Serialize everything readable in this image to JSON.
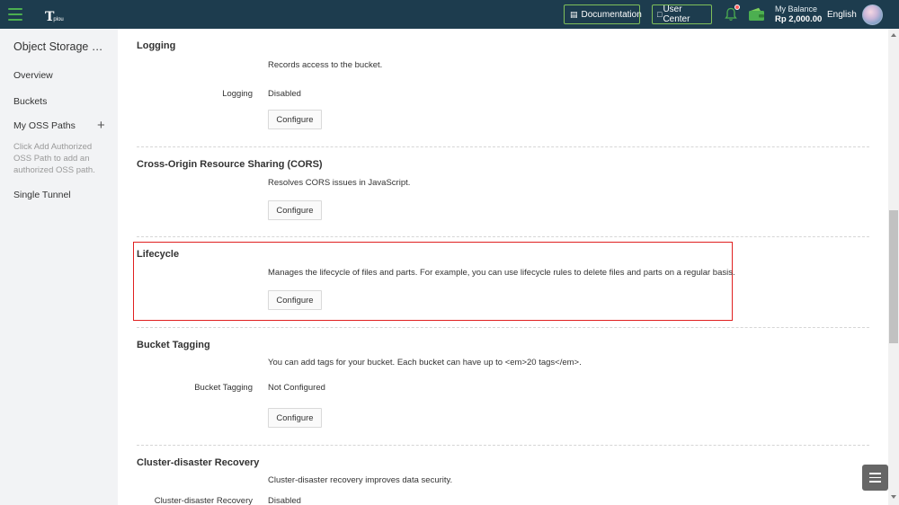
{
  "header": {
    "logo_text": "plou",
    "documentation_label": "Documentation",
    "user_center_label": "User Center",
    "balance_label": "My Balance",
    "balance_amount": "Rp 2,000.00",
    "language": "English"
  },
  "sidebar": {
    "title": "Object Storage Ser...",
    "items": [
      {
        "label": "Overview"
      },
      {
        "label": "Buckets"
      },
      {
        "label": "My OSS Paths"
      },
      {
        "label": "Single Tunnel"
      }
    ],
    "oss_hint": "Click Add Authorized OSS Path to add an authorized OSS path."
  },
  "sections": {
    "logging": {
      "title": "Logging",
      "desc": "Records access to the bucket.",
      "row_label": "Logging",
      "row_value": "Disabled",
      "button": "Configure"
    },
    "cors": {
      "title": "Cross-Origin Resource Sharing (CORS)",
      "desc": "Resolves CORS issues in JavaScript.",
      "button": "Configure"
    },
    "lifecycle": {
      "title": "Lifecycle",
      "desc": "Manages the lifecycle of files and parts. For example, you can use lifecycle rules to delete files and parts on a regular basis.",
      "button": "Configure"
    },
    "tagging": {
      "title": "Bucket Tagging",
      "desc": "You can add tags for your bucket. Each bucket can have up to <em>20 tags</em>.",
      "row_label": "Bucket Tagging",
      "row_value": "Not Configured",
      "button": "Configure"
    },
    "cluster": {
      "title": "Cluster-disaster Recovery",
      "desc": "Cluster-disaster recovery improves data security.",
      "row_label": "Cluster-disaster Recovery",
      "row_value": "Disabled"
    }
  },
  "colors": {
    "topbar": "#1d3c4e",
    "accent_green": "#4caf50",
    "highlight_red": "#e02020"
  }
}
